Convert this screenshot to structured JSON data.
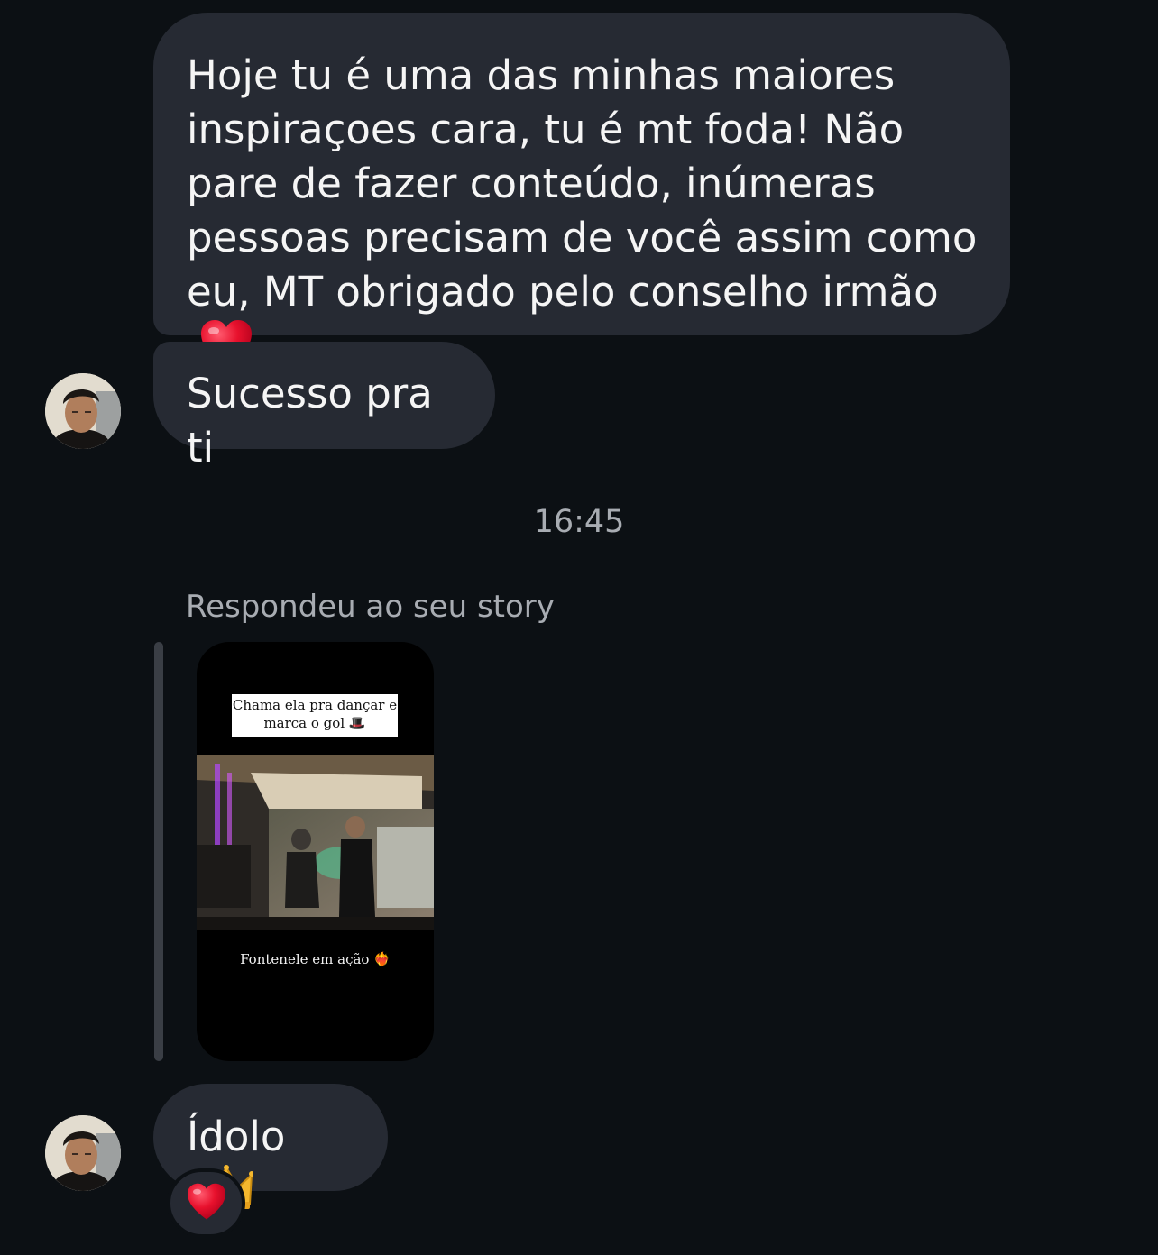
{
  "conversation": {
    "messages": [
      {
        "text": "Hoje tu é uma das minhas maiores inspiraçoes cara, tu é mt foda! Não pare de fazer conteúdo, inúmeras pessoas precisam de você assim como eu, MT obrigado pelo conselho irmão",
        "emoji": "heart-emoji"
      },
      {
        "text": "Sucesso pra ti"
      },
      {
        "text": "Ídolo",
        "emoji": "crown-emoji"
      }
    ],
    "timestamp": "16:45",
    "reply_label": "Respondeu ao seu story",
    "story": {
      "caption_line1": "Chama ela pra dançar e",
      "caption_line2": "marca o gol 🎩",
      "footer": "Fontenele em ação ❤️‍🔥"
    },
    "reaction": "heart-emoji"
  },
  "colors": {
    "background": "#0c1014",
    "bubble": "#262a33",
    "text": "#f5f5f5",
    "muted": "#a8acb2",
    "heart": "#e8112d"
  }
}
